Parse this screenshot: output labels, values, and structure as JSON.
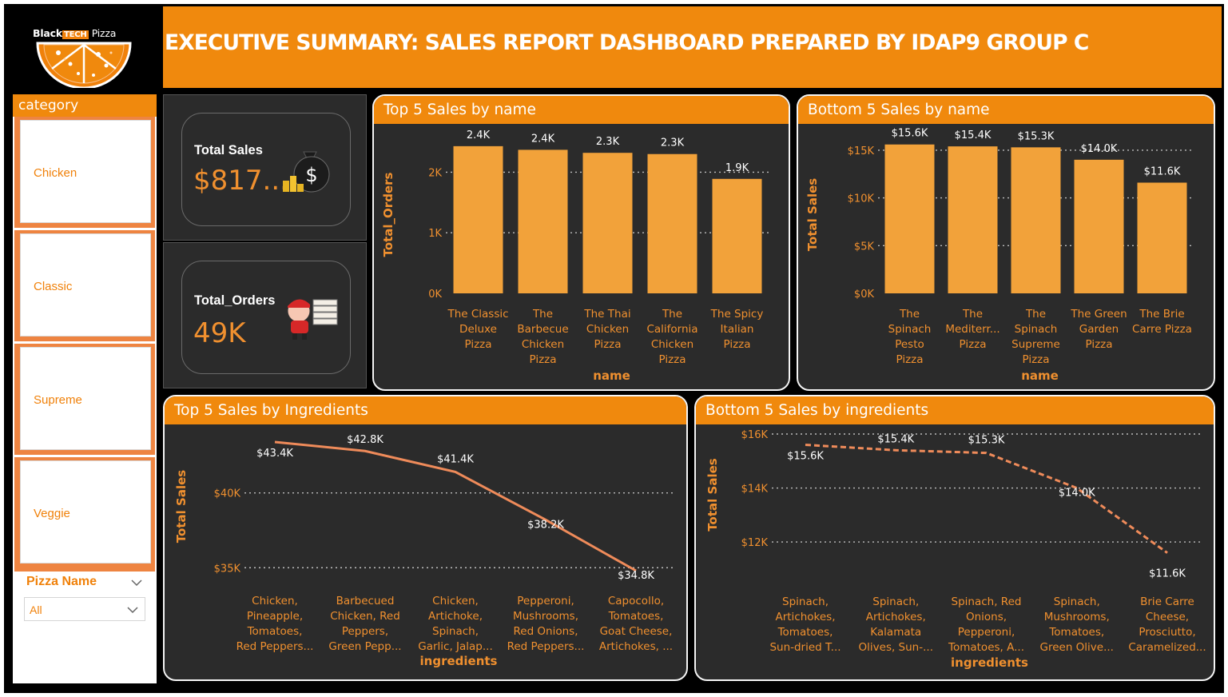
{
  "logo": {
    "brand_left": "Black",
    "brand_tech": "TECH",
    "brand_right": "Pizza"
  },
  "header": {
    "title": "EXECUTIVE SUMMARY: SALES REPORT DASHBOARD PREPARED BY IDAP9 GROUP C"
  },
  "slicer": {
    "title": "category",
    "items": [
      "Chicken",
      "Classic",
      "Supreme",
      "Veggie"
    ],
    "pizza_name_label": "Pizza Name",
    "pizza_name_value": "All"
  },
  "kpis": {
    "total_sales": {
      "label": "Total Sales",
      "value": "$817..."
    },
    "total_orders": {
      "label": "Total_Orders",
      "value": "49K"
    }
  },
  "colors": {
    "accent": "#f0890d",
    "bar": "#f2a23a",
    "line": "#ef8b5a",
    "panel": "#2b2b2b",
    "label": "#f0902f"
  },
  "icons": [
    "money-bag-icon",
    "pizza-delivery-icon",
    "chevron-down-icon"
  ],
  "chart_data": [
    {
      "id": "top5_name",
      "type": "bar",
      "title": "Top 5 Sales by name",
      "xlabel": "name",
      "ylabel": "Total_Orders",
      "categories": [
        [
          "The Classic",
          "Deluxe",
          "Pizza"
        ],
        [
          "The",
          "Barbecue",
          "Chicken",
          "Pizza"
        ],
        [
          "The Thai",
          "Chicken",
          "Pizza"
        ],
        [
          "The",
          "California",
          "Chicken",
          "Pizza"
        ],
        [
          "The Spicy",
          "Italian",
          "Pizza"
        ]
      ],
      "values": [
        2430,
        2370,
        2320,
        2300,
        1890
      ],
      "data_labels": [
        "2.4K",
        "2.4K",
        "2.3K",
        "2.3K",
        "1.9K"
      ],
      "ylim": [
        0,
        2600
      ],
      "yticks": [
        0,
        1000,
        2000
      ],
      "ytick_labels": [
        "0K",
        "1K",
        "2K"
      ],
      "grid": true
    },
    {
      "id": "bottom5_name",
      "type": "bar",
      "title": "Bottom 5 Sales by name",
      "xlabel": "name",
      "ylabel": "Total Sales",
      "categories": [
        [
          "The",
          "Spinach",
          "Pesto",
          "Pizza"
        ],
        [
          "The",
          "Mediterr...",
          "Pizza"
        ],
        [
          "The",
          "Spinach",
          "Supreme",
          "Pizza"
        ],
        [
          "The Green",
          "Garden",
          "Pizza"
        ],
        [
          "The Brie",
          "Carre Pizza"
        ]
      ],
      "values": [
        15600,
        15400,
        15300,
        14000,
        11600
      ],
      "data_labels": [
        "$15.6K",
        "$15.4K",
        "$15.3K",
        "$14.0K",
        "$11.6K"
      ],
      "ylim": [
        0,
        16500
      ],
      "yticks": [
        0,
        5000,
        10000,
        15000
      ],
      "ytick_labels": [
        "$0K",
        "$5K",
        "$10K",
        "$15K"
      ],
      "grid": true
    },
    {
      "id": "top5_ingredients",
      "type": "line",
      "title": "Top 5 Sales by Ingredients",
      "xlabel": "ingredients",
      "ylabel": "Total Sales",
      "categories": [
        [
          "Chicken,",
          "Pineapple,",
          "Tomatoes,",
          "Red Peppers..."
        ],
        [
          "Barbecued",
          "Chicken, Red",
          "Peppers,",
          "Green Pepp..."
        ],
        [
          "Chicken,",
          "Artichoke,",
          "Spinach,",
          "Garlic, Jalap..."
        ],
        [
          "Pepperoni,",
          "Mushrooms,",
          "Red Onions,",
          "Red Peppers..."
        ],
        [
          "Capocollo,",
          "Tomatoes,",
          "Goat Cheese,",
          "Artichokes, ..."
        ]
      ],
      "values": [
        43400,
        42800,
        41400,
        38200,
        34800
      ],
      "data_labels": [
        "$43.4K",
        "$42.8K",
        "$41.4K",
        "$38.2K",
        "$34.8K"
      ],
      "ylim": [
        34800,
        43400
      ],
      "yticks": [
        35000,
        40000
      ],
      "ytick_labels": [
        "$35K",
        "$40K"
      ],
      "line_style": "solid",
      "grid": true
    },
    {
      "id": "bottom5_ingredients",
      "type": "line",
      "title": "Bottom 5 Sales by ingredients",
      "xlabel": "ingredients",
      "ylabel": "Total Sales",
      "categories": [
        [
          "Spinach,",
          "Artichokes,",
          "Tomatoes,",
          "Sun-dried T..."
        ],
        [
          "Spinach,",
          "Artichokes,",
          "Kalamata",
          "Olives, Sun-..."
        ],
        [
          "Spinach, Red",
          "Onions,",
          "Pepperoni,",
          "Tomatoes, A..."
        ],
        [
          "Spinach,",
          "Mushrooms,",
          "Tomatoes,",
          "Green Olive..."
        ],
        [
          "Brie Carre",
          "Cheese,",
          "Prosciutto,",
          "Caramelized..."
        ]
      ],
      "values": [
        15600,
        15400,
        15300,
        14000,
        11600
      ],
      "data_labels": [
        "$15.6K",
        "$15.4K",
        "$15.3K",
        "$14.0K",
        "$11.6K"
      ],
      "ylim": [
        11500,
        16000
      ],
      "yticks": [
        12000,
        14000,
        16000
      ],
      "ytick_labels": [
        "$12K",
        "$14K",
        "$16K"
      ],
      "line_style": "dashed",
      "grid": true
    }
  ]
}
